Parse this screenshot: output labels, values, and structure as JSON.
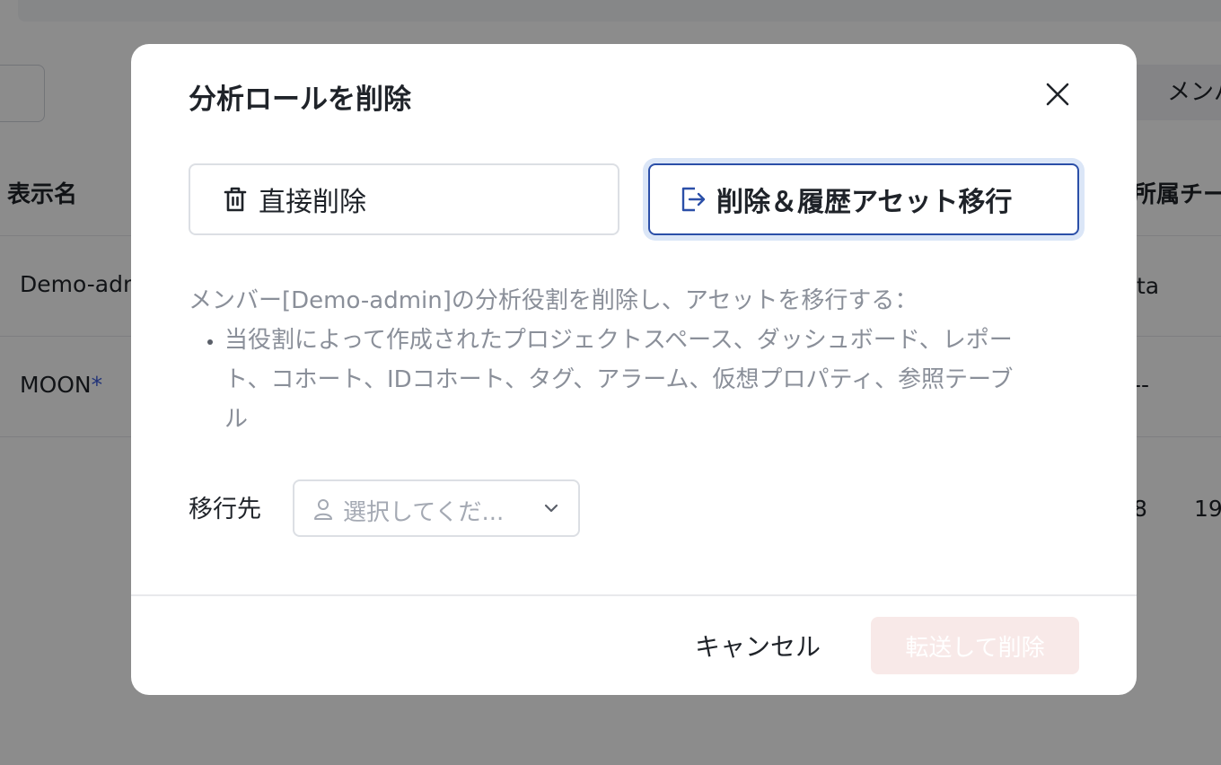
{
  "background": {
    "member_button_label": "メンバ",
    "table_headers": {
      "display_name": "表示名",
      "team": "所属チー"
    },
    "rows": [
      {
        "name": "Demo-adm",
        "team_value": "ta"
      },
      {
        "name": "MOON",
        "required_mark": "*",
        "team_value": "--"
      }
    ],
    "pagination": {
      "value_a": "8",
      "value_b": "19"
    }
  },
  "modal": {
    "title": "分析ロールを削除",
    "close_icon": "close-icon",
    "options": {
      "direct": {
        "label": "直接削除",
        "icon": "trash-icon",
        "selected": false
      },
      "transfer": {
        "label": "削除＆履歴アセット移行",
        "icon": "export-icon",
        "selected": true
      }
    },
    "description": {
      "intro": "メンバー[Demo-admin]の分析役割を削除し、アセットを移行する：",
      "bullet_lines": [
        "当役割によって作成されたプロジェクトスペース、ダッシュボード、レポー",
        "ト、コホート、IDコホート、タグ、アラーム、仮想プロパティ、参照テーブ",
        "ル"
      ]
    },
    "destination": {
      "label": "移行先",
      "placeholder": "選択してくだ...",
      "icon": "user-icon"
    },
    "footer": {
      "cancel_label": "キャンセル",
      "submit_label": "転送して削除",
      "submit_disabled": true
    },
    "colors": {
      "accent": "#2b4fa8",
      "submit_disabled_bg": "#f8e9e8"
    }
  }
}
